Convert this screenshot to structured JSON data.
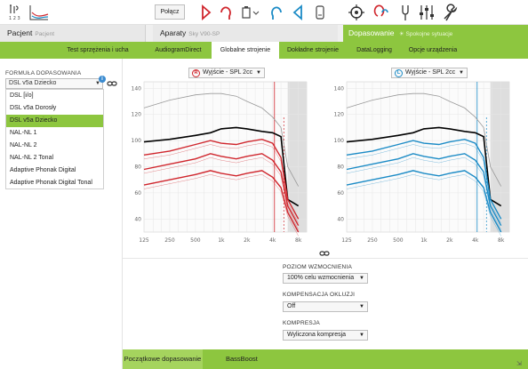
{
  "toolbar": {
    "items": [
      {
        "name": "audiogram-settings-icon",
        "sub": "1 2 3"
      },
      {
        "name": "audiogram-chart-icon"
      },
      {
        "name": "connect"
      },
      {
        "name": "red-hearing-aid-icon"
      },
      {
        "name": "red-earpiece-icon"
      },
      {
        "name": "battery-dropdown-icon"
      },
      {
        "name": "blue-earpiece-icon"
      },
      {
        "name": "blue-hearing-aid-icon"
      },
      {
        "name": "remote-icon"
      },
      {
        "name": "target-icon"
      },
      {
        "name": "ear-probe-icon"
      },
      {
        "name": "tuning-fork-icon"
      },
      {
        "name": "equalizer-icon"
      },
      {
        "name": "wrench-icon"
      }
    ],
    "connect_label": "Połącz",
    "badge_digits": "1 2 3"
  },
  "nav": {
    "patient_label": "Pacjent",
    "patient_sub": "Pacjent",
    "devices_label": "Aparaty",
    "devices_sub": "Sky V90-SP",
    "fitting_label": "Dopasowanie",
    "fitting_sub": "Spokojne sytuacje"
  },
  "tabs": [
    {
      "label": "Test sprzężenia i ucha rzeczywistego",
      "active": false
    },
    {
      "label": "AudiogramDirect",
      "active": false
    },
    {
      "label": "Globalne strojenie",
      "active": true
    },
    {
      "label": "Dokładne strojenie",
      "active": false
    },
    {
      "label": "DataLogging",
      "active": false
    },
    {
      "label": "Opcje urządzenia",
      "active": false
    }
  ],
  "formula": {
    "label": "FORMUŁA DOPASOWANIA",
    "selected": "DSL v5a Dziecko",
    "options": [
      "DSL [i/o]",
      "DSL v5a Dorosły",
      "DSL v5a Dziecko",
      "NAL-NL 1",
      "NAL-NL 2",
      "NAL-NL 2 Tonal",
      "Adaptive Phonak Digital",
      "Adaptive Phonak Digital Tonal"
    ]
  },
  "charts": {
    "right_ear": {
      "badge": "R",
      "output_label": "Wyjście - SPL 2cc",
      "color": "#d0262d"
    },
    "left_ear": {
      "badge": "L",
      "output_label": "Wyjście - SPL 2cc",
      "color": "#1b8bc6"
    },
    "y_ticks": [
      "140",
      "120",
      "100",
      "80",
      "60",
      "40"
    ],
    "x_ticks": [
      "125",
      "250",
      "500",
      "1k",
      "2k",
      "4k",
      "8k"
    ]
  },
  "chart_data": [
    {
      "type": "line",
      "title": "",
      "ear": "right",
      "xscale": "log",
      "x": [
        125,
        250,
        500,
        750,
        1000,
        1500,
        2000,
        3000,
        4000,
        5000,
        6000,
        8000
      ],
      "ylim": [
        30,
        145
      ],
      "series": [
        {
          "values": [
            125,
            131,
            135,
            136,
            136,
            134,
            130,
            125,
            118,
            110,
            80,
            65
          ],
          "color": "#999999"
        },
        {
          "values": [
            99,
            101,
            104,
            106,
            109,
            110,
            109,
            107,
            106,
            103,
            55,
            50
          ],
          "color": "#000000"
        },
        {
          "values": [
            89,
            92,
            97,
            100,
            98,
            97,
            99,
            101,
            98,
            87,
            55,
            40
          ],
          "color": "#d0262d"
        },
        {
          "values": [
            78,
            82,
            86,
            90,
            88,
            86,
            88,
            90,
            85,
            76,
            50,
            35
          ],
          "color": "#d0262d"
        },
        {
          "values": [
            66,
            70,
            74,
            77,
            75,
            73,
            75,
            77,
            72,
            64,
            45,
            30
          ],
          "color": "#d0262d"
        }
      ]
    },
    {
      "type": "line",
      "title": "",
      "ear": "left",
      "xscale": "log",
      "x": [
        125,
        250,
        500,
        750,
        1000,
        1500,
        2000,
        3000,
        4000,
        5000,
        6000,
        8000
      ],
      "ylim": [
        30,
        145
      ],
      "series": [
        {
          "values": [
            125,
            131,
            135,
            136,
            136,
            134,
            130,
            125,
            118,
            110,
            80,
            65
          ],
          "color": "#999999"
        },
        {
          "values": [
            99,
            101,
            104,
            106,
            109,
            110,
            109,
            107,
            106,
            103,
            55,
            50
          ],
          "color": "#000000"
        },
        {
          "values": [
            89,
            92,
            97,
            100,
            98,
            97,
            99,
            101,
            98,
            87,
            55,
            40
          ],
          "color": "#1b8bc6"
        },
        {
          "values": [
            78,
            82,
            86,
            90,
            88,
            86,
            88,
            90,
            85,
            76,
            50,
            35
          ],
          "color": "#1b8bc6"
        },
        {
          "values": [
            66,
            70,
            74,
            77,
            75,
            73,
            75,
            77,
            72,
            64,
            45,
            30
          ],
          "color": "#1b8bc6"
        }
      ]
    }
  ],
  "controls": {
    "gain_label": "POZIOM WZMOCNIENIA",
    "gain_value": "100% celu wzmocnienia",
    "occlusion_label": "KOMPENSACJA OKLUZJI",
    "occlusion_value": "Off",
    "compression_label": "KOMPRESJA",
    "compression_value": "Wyliczona kompresja"
  },
  "bottom": {
    "tab1": "Początkowe dopasowanie",
    "tab2": "BassBoost"
  },
  "colors": {
    "accent": "#8dc63f",
    "right": "#d0262d",
    "left": "#1b8bc6"
  }
}
